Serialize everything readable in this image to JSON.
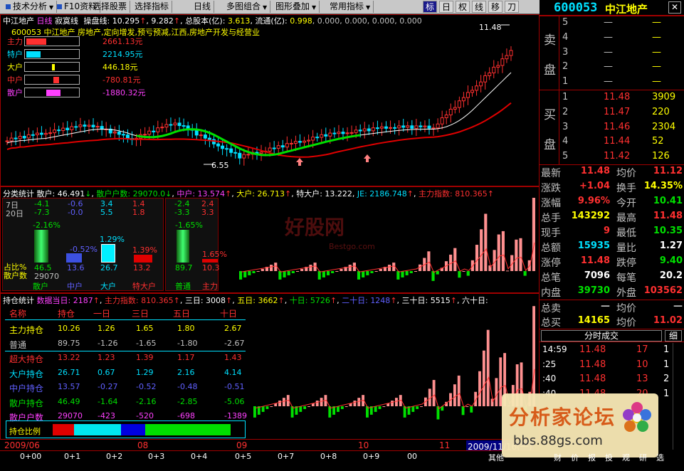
{
  "menu": [
    {
      "label": "技术分析",
      "icon": true,
      "dd": true
    },
    {
      "label": "F10资料",
      "icon": true,
      "dd": false
    },
    {
      "label": "选择股票",
      "icon": false,
      "dd": false
    },
    {
      "label": "选择指标",
      "icon": false,
      "dd": false
    },
    {
      "label": "日线",
      "icon": false,
      "dd": false
    },
    {
      "label": "多图组合",
      "icon": false,
      "dd": true
    },
    {
      "label": "图形叠加",
      "icon": false,
      "dd": true
    },
    {
      "label": "常用指标",
      "icon": false,
      "dd": true
    }
  ],
  "toolbar_btns": [
    "标",
    "日",
    "权",
    "线",
    "移",
    "刀"
  ],
  "stock": {
    "code": "600053",
    "name": "中江地产",
    "close_btn": "✕"
  },
  "main": {
    "header": {
      "name": "中江地产",
      "period": "日线",
      "line": "寂寞线",
      "line2": "操盘线",
      "v1": "10.295",
      "v2": "9.282",
      "cap_label": "总股本(亿)",
      "cap": "3.613",
      "float_label": "流通(亿)",
      "float": "0.998",
      "z1": "0.000",
      "z2": "0.000",
      "z3": "0.000",
      "z4": "0.000"
    },
    "info": "600053 中江地产 房地产,定向增发,预亏预减,江西,房地产开发与经营业",
    "hi_label": "11.48",
    "lo_label": "6.55",
    "flows": [
      {
        "label": "主力",
        "value": "2661.13元",
        "color": "#ff3030"
      },
      {
        "label": "特户",
        "value": "2214.95元",
        "color": "#00e0ff"
      },
      {
        "label": "大户",
        "value": "446.18元",
        "color": "#ffff00"
      },
      {
        "label": "中户",
        "value": "-780.81元",
        "color": "#ff3030"
      },
      {
        "label": "散户",
        "value": "-1880.32元",
        "color": "#ff40ff"
      }
    ]
  },
  "cls": {
    "header": {
      "title": "分类统计",
      "sh_label": "散户",
      "sh": "46.491",
      "shcount_label": "散户户数",
      "shcount": "29070.0",
      "mid_label": "中户",
      "mid": "13.574",
      "big_label": "大户",
      "big": "26.713",
      "sp_label": "特大户",
      "sp": "13.222",
      "je_label": "JE",
      "je": "2186.748",
      "main_label": "主力指数",
      "main": "810.365"
    },
    "rows": [
      {
        "label": "7日",
        "v": [
          "-4.1",
          "-0.6",
          "3.4",
          "1.4"
        ],
        "v2": [
          "-2.4",
          "2.4"
        ]
      },
      {
        "label": "20日",
        "v": [
          "-7.3",
          "-0.0",
          "5.5",
          "1.8"
        ],
        "v2": [
          "-3.3",
          "3.3"
        ]
      }
    ],
    "pct_a": "-2.16%",
    "pct_b": "-0.52%",
    "pct_c": "1.29%",
    "pct_d": "1.39%",
    "pct_e": "-1.65%",
    "pct_f": "1.65%",
    "zb_label": "占比%",
    "shs_label": "散户数",
    "bottom_vals": [
      "46.5",
      "13.6",
      "26.7",
      "13.2",
      "89.7",
      "10.3"
    ],
    "bottom_count": "29070",
    "cats": [
      "散户",
      "中户",
      "大户",
      "特大户",
      "普通",
      "主力"
    ]
  },
  "hold": {
    "header": {
      "title": "持仓统计",
      "today_label": "数据当日",
      "today": "2187",
      "main_label": "主力指数",
      "main": "810.365",
      "d3_label": "三日",
      "d3": "3008",
      "d5_label": "五日",
      "d5": "3662",
      "d10_label": "十日",
      "d10": "5726",
      "d20_label": "二十日",
      "d20": "1248",
      "d30_label": "三十日",
      "d30": "5515",
      "d60_label": "六十日"
    },
    "cols": [
      "名称",
      "持仓",
      "一日",
      "三日",
      "五日",
      "十日"
    ],
    "rows": [
      {
        "name": "主力持仓",
        "v": [
          "10.26",
          "1.26",
          "1.65",
          "1.80",
          "2.67"
        ],
        "nc": "#ffff00",
        "vc": "#ffff00"
      },
      {
        "name": "普通",
        "v": [
          "89.75",
          "-1.26",
          "-1.65",
          "-1.80",
          "-2.67"
        ],
        "nc": "#c0c0c0",
        "vc": "#c0c0c0"
      },
      {
        "name": "超大持仓",
        "v": [
          "13.22",
          "1.23",
          "1.39",
          "1.17",
          "1.43"
        ],
        "nc": "#ff3030",
        "vc": "#ff3030"
      },
      {
        "name": "大户持仓",
        "v": [
          "26.71",
          "0.67",
          "1.29",
          "2.16",
          "4.14"
        ],
        "nc": "#00e0ff",
        "vc": "#00e0ff"
      },
      {
        "name": "中户持仓",
        "v": [
          "13.57",
          "-0.27",
          "-0.52",
          "-0.48",
          "-0.51"
        ],
        "nc": "#6060ff",
        "vc": "#6060ff"
      },
      {
        "name": "散户持仓",
        "v": [
          "46.49",
          "-1.64",
          "-2.16",
          "-2.85",
          "-5.06"
        ],
        "nc": "#00e000",
        "vc": "#00e000"
      },
      {
        "name": "散户户数",
        "v": [
          "29070",
          "-423",
          "-520",
          "-698",
          "-1389"
        ],
        "nc": "#ff40ff",
        "vc": "#ff40ff"
      }
    ],
    "ratio_label": "持仓比例"
  },
  "watermark": {
    "wm1": "好股网",
    "wm2": "Bestgo.com",
    "wm3": "分析家论坛",
    "wm4": "bbs.88gs.com"
  },
  "orderbook": {
    "sell_label": [
      "卖",
      "盘"
    ],
    "buy_label": [
      "买",
      "盘"
    ],
    "sells": [
      {
        "n": "5",
        "p": "—",
        "v": "—"
      },
      {
        "n": "4",
        "p": "—",
        "v": "—"
      },
      {
        "n": "3",
        "p": "—",
        "v": "—"
      },
      {
        "n": "2",
        "p": "—",
        "v": "—"
      },
      {
        "n": "1",
        "p": "—",
        "v": "—"
      }
    ],
    "buys": [
      {
        "n": "1",
        "p": "11.48",
        "v": "3909"
      },
      {
        "n": "2",
        "p": "11.47",
        "v": "220"
      },
      {
        "n": "3",
        "p": "11.46",
        "v": "2304"
      },
      {
        "n": "4",
        "p": "11.44",
        "v": "52"
      },
      {
        "n": "5",
        "p": "11.42",
        "v": "126"
      }
    ]
  },
  "quote": [
    {
      "l1": "最新",
      "v1": "11.48",
      "c1": "#ff3030",
      "l2": "均价",
      "v2": "11.12",
      "c2": "#ff3030"
    },
    {
      "l1": "涨跌",
      "v1": "+1.04",
      "c1": "#ff3030",
      "l2": "换手",
      "v2": "14.35%",
      "c2": "#ffff00"
    },
    {
      "l1": "涨幅",
      "v1": "9.96%",
      "c1": "#ff3030",
      "l2": "今开",
      "v2": "10.41",
      "c2": "#00e000"
    },
    {
      "l1": "总手",
      "v1": "143292",
      "c1": "#ffff00",
      "l2": "最高",
      "v2": "11.48",
      "c2": "#ff3030"
    },
    {
      "l1": "现手",
      "v1": "9",
      "c1": "#ff3030",
      "l2": "最低",
      "v2": "10.35",
      "c2": "#00e000"
    },
    {
      "l1": "总额",
      "v1": "15935",
      "c1": "#00e0ff",
      "l2": "量比",
      "v2": "1.27",
      "c2": "#ffffff"
    },
    {
      "l1": "涨停",
      "v1": "11.48",
      "c1": "#ff3030",
      "l2": "跌停",
      "v2": "9.40",
      "c2": "#00e000"
    },
    {
      "l1": "总笔",
      "v1": "7096",
      "c1": "#ffffff",
      "l2": "每笔",
      "v2": "20.2",
      "c2": "#ffffff"
    },
    {
      "l1": "内盘",
      "v1": "39730",
      "c1": "#00e000",
      "l2": "外盘",
      "v2": "103562",
      "c2": "#ff3030"
    }
  ],
  "totals": [
    {
      "l1": "总卖",
      "v1": "—",
      "c1": "#c0c0c0",
      "l2": "均价",
      "v2": "—",
      "c2": "#c0c0c0"
    },
    {
      "l1": "总买",
      "v1": "14165",
      "c1": "#ffff00",
      "l2": "均价",
      "v2": "11.02",
      "c2": "#ff3030"
    }
  ],
  "tick_tab": "分时成交",
  "tick_tab2": "细",
  "ticks": [
    {
      "t": "14:59",
      "p": "11.48",
      "v": "17",
      "d": "1"
    },
    {
      "t": ":25",
      "p": "11.48",
      "v": "10",
      "d": "1"
    },
    {
      "t": ":40",
      "p": "11.48",
      "v": "13",
      "d": "2"
    },
    {
      "t": ":40",
      "p": "11.48",
      "v": "20",
      "d": "1"
    }
  ],
  "dates": [
    "2009/06",
    "08",
    "09",
    "10",
    "11",
    "2009/11/16(一)"
  ],
  "tabs": [
    "0+00",
    "0+1",
    "0+2",
    "0+3",
    "0+4",
    "0+5",
    "0+7",
    "0+8",
    "0+9",
    "00",
    "其他"
  ],
  "bottom_menu": [
    "财",
    "价",
    "报",
    "投",
    "观",
    "研",
    "选"
  ],
  "chart_data": {
    "type": "candlestick",
    "price_max": "11.48",
    "price_min": "6.55",
    "series": [
      {
        "name": "寂寞线"
      },
      {
        "name": "操盘线"
      }
    ]
  }
}
